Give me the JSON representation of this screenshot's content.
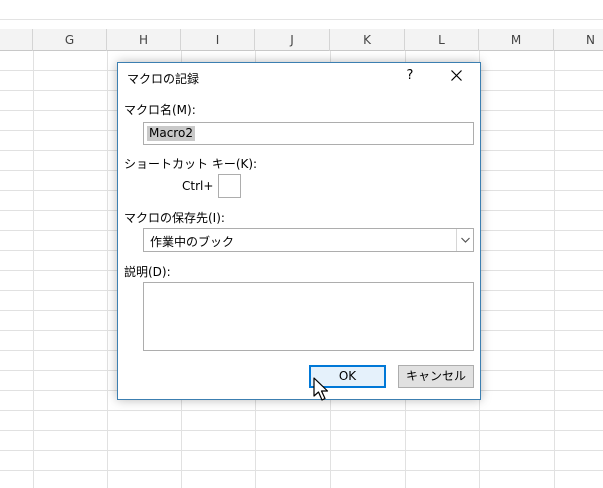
{
  "sheet": {
    "columns": [
      "G",
      "H",
      "I",
      "J",
      "K",
      "L",
      "M",
      "N"
    ]
  },
  "dialog": {
    "title": "マクロの記録",
    "help_glyph": "?",
    "close_glyph": "✕",
    "macro_name_label": "マクロ名(M):",
    "macro_name_value": "Macro2",
    "shortcut_label": "ショートカット キー(K):",
    "ctrl_prefix": "Ctrl+",
    "shortcut_value": "",
    "store_label": "マクロの保存先(I):",
    "store_value": "作業中のブック",
    "description_label": "説明(D):",
    "description_value": "",
    "ok_label": "OK",
    "cancel_label": "キャンセル"
  },
  "icons": {
    "help": "question-mark-icon",
    "close": "close-icon",
    "dropdown": "chevron-down-icon",
    "pointer": "mouse-pointer-icon"
  },
  "colors": {
    "dialog_border": "#3c7fb1",
    "default_button_border": "#0078d7",
    "selection_highlight": "#c9c9c9"
  }
}
